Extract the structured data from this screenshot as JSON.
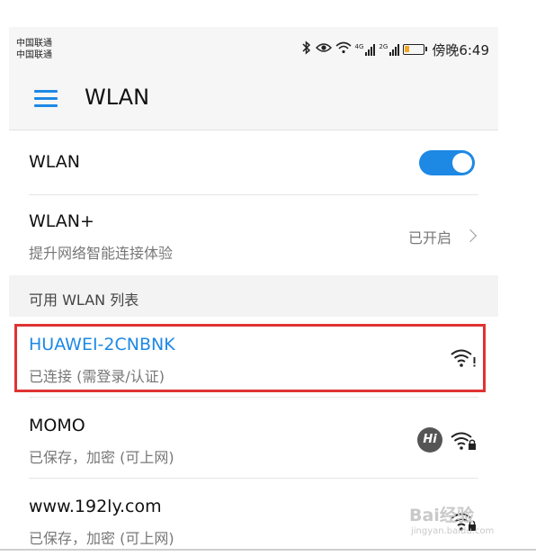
{
  "status_bar": {
    "carrier_1": "中国联通",
    "carrier_2": "中国联通",
    "network_1": "4G",
    "network_2": "2G",
    "time": "傍晚6:49",
    "icons": [
      "bluetooth-icon",
      "eye-icon",
      "wifi-status-icon",
      "signal-icon",
      "signal-icon",
      "battery-icon"
    ]
  },
  "app_bar": {
    "menu_icon": "hamburger-menu-icon",
    "title": "WLAN"
  },
  "settings": {
    "wlan_label": "WLAN",
    "wlan_enabled": true,
    "wlan_plus_label": "WLAN+",
    "wlan_plus_sub": "提升网络智能连接体验",
    "wlan_plus_value": "已开启"
  },
  "network_list": {
    "header": "可用 WLAN 列表",
    "networks": [
      {
        "ssid": "HUAWEI-2CNBNK",
        "status": "已连接 (需登录/认证)",
        "connected": true,
        "icon": "wifi-warning-icon",
        "accent": "#1e88e5"
      },
      {
        "ssid": "MOMO",
        "status": "已保存，加密 (可上网)",
        "connected": false,
        "badge": "Hi",
        "icon": "wifi-lock-icon"
      },
      {
        "ssid": "www.192ly.com",
        "status": "已保存，加密 (可上网)",
        "connected": false,
        "icon": "wifi-lock-icon"
      }
    ]
  },
  "watermark": {
    "brand": "Bai经验",
    "url": "jingyan.baidu.com"
  },
  "colors": {
    "accent": "#1e88e5",
    "highlight_border": "#e03333",
    "secondary_text": "#777777"
  }
}
